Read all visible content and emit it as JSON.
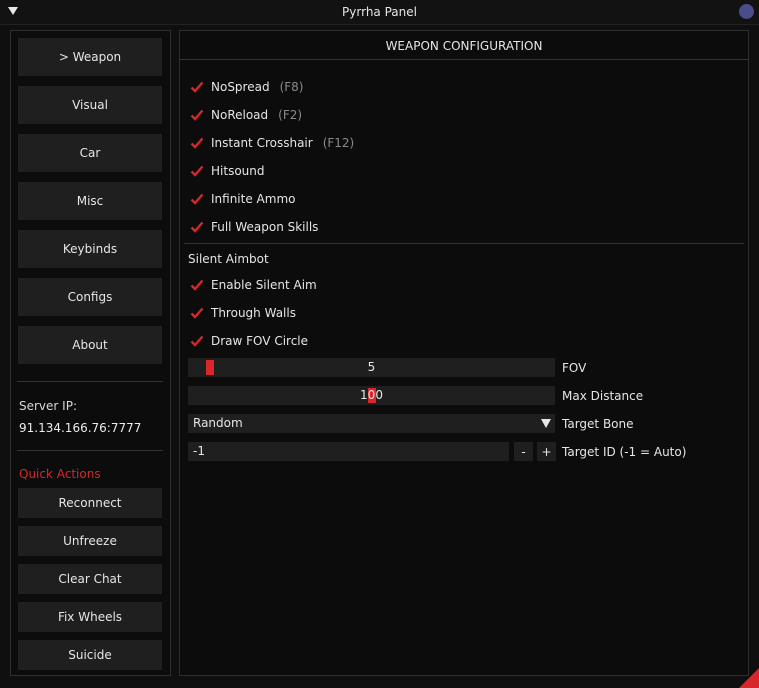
{
  "window": {
    "title": "Pyrrha Panel"
  },
  "sidebar": {
    "nav": [
      "> Weapon",
      "Visual",
      "Car",
      "Misc",
      "Keybinds",
      "Configs",
      "About"
    ],
    "server_ip_label": "Server IP:",
    "server_ip_value": "91.134.166.76:7777",
    "quick_actions_title": "Quick Actions",
    "quick_actions": [
      "Reconnect",
      "Unfreeze",
      "Clear Chat",
      "Fix Wheels",
      "Suicide"
    ]
  },
  "main": {
    "header": "WEAPON CONFIGURATION",
    "options": [
      {
        "label": "NoSpread",
        "hotkey": "(F8)",
        "checked": true
      },
      {
        "label": "NoReload",
        "hotkey": "(F2)",
        "checked": true
      },
      {
        "label": "Instant Crosshair",
        "hotkey": "(F12)",
        "checked": true
      },
      {
        "label": "Hitsound",
        "hotkey": "",
        "checked": true
      },
      {
        "label": "Infinite Ammo",
        "hotkey": "",
        "checked": true
      },
      {
        "label": "Full Weapon Skills",
        "hotkey": "",
        "checked": true
      }
    ],
    "silent_aimbot": {
      "title": "Silent Aimbot",
      "options": [
        {
          "label": "Enable Silent Aim",
          "checked": true
        },
        {
          "label": "Through Walls",
          "checked": true
        },
        {
          "label": "Draw FOV Circle",
          "checked": true
        }
      ],
      "fov": {
        "value": "5",
        "label": "FOV",
        "fraction": 0.0
      },
      "max_distance": {
        "value": "100",
        "label": "Max Distance",
        "fraction": 0.5
      },
      "target_bone": {
        "value": "Random",
        "label": "Target Bone"
      },
      "target_id": {
        "value": "-1",
        "label": "Target ID (-1 = Auto)",
        "minus": "-",
        "plus": "+"
      }
    }
  },
  "colors": {
    "accent": "#d9262b",
    "button": "#1f1f1f",
    "background": "#0c0c0c"
  }
}
